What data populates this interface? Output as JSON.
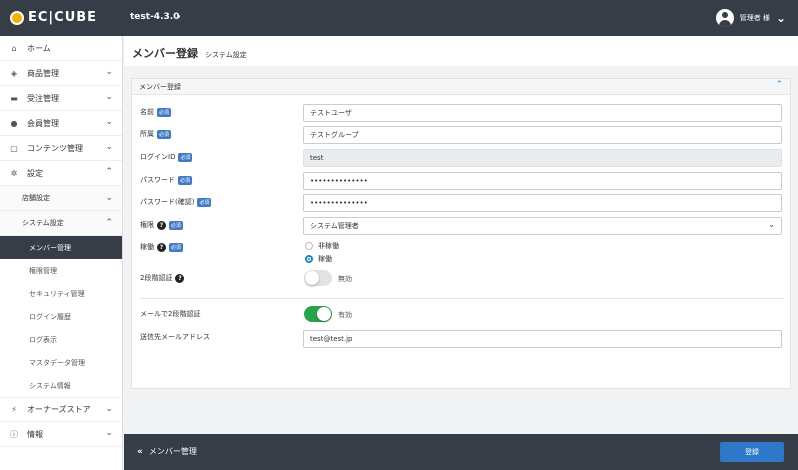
{
  "header": {
    "logo_text": "EC|CUBE",
    "shop_name": "test-4.3.0",
    "user_label": "管理者 様"
  },
  "sidebar": {
    "items": [
      {
        "label": "ホーム",
        "icon": "home-icon"
      },
      {
        "label": "商品管理",
        "icon": "cube-icon"
      },
      {
        "label": "受注管理",
        "icon": "cart-icon"
      },
      {
        "label": "会員管理",
        "icon": "users-icon"
      },
      {
        "label": "コンテンツ管理",
        "icon": "file-icon"
      },
      {
        "label": "設定",
        "icon": "gear-icon"
      }
    ],
    "settings_sub": [
      {
        "label": "店舗設定"
      },
      {
        "label": "システム設定"
      }
    ],
    "system_leaves": [
      {
        "label": "メンバー管理",
        "active": true
      },
      {
        "label": "権限管理"
      },
      {
        "label": "セキュリティ管理"
      },
      {
        "label": "ログイン履歴"
      },
      {
        "label": "ログ表示"
      },
      {
        "label": "マスタデータ管理"
      },
      {
        "label": "システム情報"
      }
    ],
    "bottom_items": [
      {
        "label": "オーナーズストア",
        "icon": "plug-icon"
      },
      {
        "label": "情報",
        "icon": "info-icon"
      }
    ]
  },
  "page": {
    "title": "メンバー登録",
    "subtitle": "システム設定"
  },
  "form": {
    "card_title": "メンバー登録",
    "required_badge": "必須",
    "name_label": "名前",
    "name_value": "テストユーザ",
    "group_label": "所属",
    "group_value": "テストグループ",
    "loginid_label": "ログインID",
    "loginid_value": "test",
    "password_label": "パスワード",
    "password_value": "••••••••••••••",
    "password_confirm_label": "パスワード(確認)",
    "password_confirm_value": "••••••••••••••",
    "role_label": "権限",
    "role_value": "システム管理者",
    "status_label": "稼働",
    "status_options": [
      "非稼働",
      "稼働"
    ],
    "status_selected": "稼働",
    "twofa_label": "2段階認証",
    "twofa_state": "無効",
    "mail_twofa_label": "メールで2段階認証",
    "mail_twofa_state": "有効",
    "email_label": "送信先メールアドレス",
    "email_value": "test@test.jp"
  },
  "footer": {
    "back_label": "メンバー管理",
    "save_label": "登録"
  },
  "colors": {
    "header_bg": "#363d46",
    "accent": "#2d78c8",
    "required_badge": "#4079c6",
    "toggle_on": "#25a548"
  }
}
